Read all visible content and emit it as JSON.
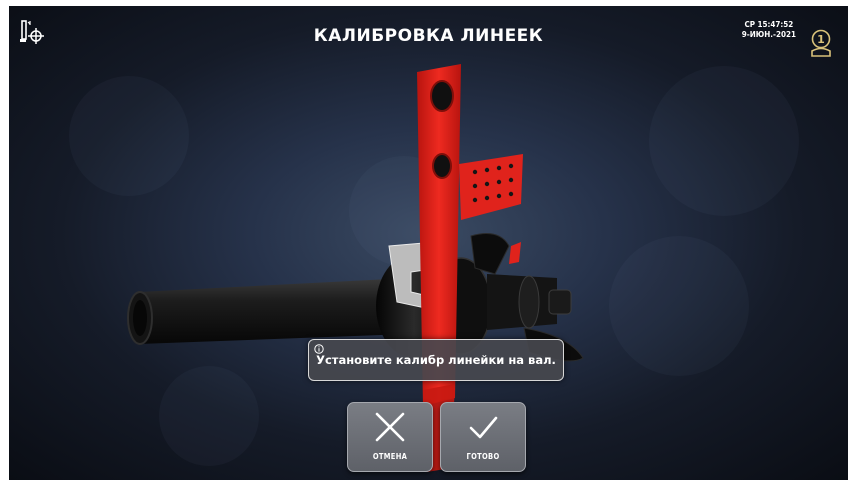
{
  "header": {
    "title": "КАЛИБРОВКА ЛИНЕЕК",
    "date_line1": "СР 15:47:52",
    "date_line2": "9-ИЮН.-2021",
    "logo_icon": "alignment-camera-icon",
    "user_icon": "user-1-icon",
    "user_number": "1"
  },
  "message": {
    "icon": "info-icon",
    "text": "Установите калибр линейки на вал."
  },
  "buttons": {
    "cancel_label": "ОТМЕНА",
    "cancel_icon": "x-icon",
    "ok_label": "ГОТОВО",
    "ok_icon": "check-icon"
  },
  "colors": {
    "accent_red": "#e0231c",
    "button_gray": "#6a6d74",
    "background": "#1a2232"
  }
}
